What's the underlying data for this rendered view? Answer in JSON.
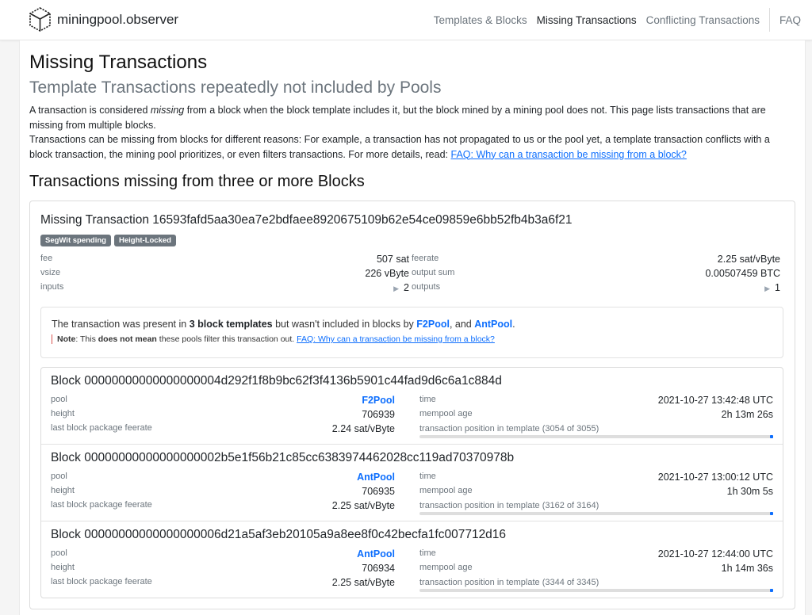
{
  "brand": {
    "name": "miningpool.observer",
    "logo_icon": "cube-icon"
  },
  "nav": {
    "items": [
      {
        "label": "Templates & Blocks",
        "active": false
      },
      {
        "label": "Missing Transactions",
        "active": true
      },
      {
        "label": "Conflicting Transactions",
        "active": false
      }
    ],
    "faq": "FAQ"
  },
  "page": {
    "title": "Missing Transactions",
    "subtitle": "Template Transactions repeatedly not included by Pools",
    "intro_1_a": "A transaction is considered ",
    "intro_1_em": "missing",
    "intro_1_b": " from a block when the block template includes it, but the block mined by a mining pool does not. This page lists transactions that are missing from multiple blocks.",
    "intro_2": "Transactions can be missing from blocks for different reasons: For example, a transaction has not propagated to us or the pool yet, a template transaction conflicts with a block transaction, the mining pool prioritizes, or even filters transactions. For more details, read: ",
    "intro_2_link": "FAQ: Why can a transaction be missing from a block?",
    "section_title": "Transactions missing from three or more Blocks"
  },
  "transaction": {
    "title": "Missing Transaction 16593fafd5aa30ea7e2bdfaee8920675109b62e54ce09859e6bb52fb4b3a6f21",
    "badges": [
      "SegWit spending",
      "Height-Locked"
    ],
    "fee_label": "fee",
    "fee": "507 sat",
    "vsize_label": "vsize",
    "vsize": "226 vByte",
    "inputs_label": "inputs",
    "inputs": "2",
    "feerate_label": "feerate",
    "feerate": "2.25 sat/vByte",
    "output_sum_label": "output sum",
    "output_sum": "0.00507459 BTC",
    "outputs_label": "outputs",
    "outputs": "1",
    "notice": {
      "text_a": "The transaction was present in ",
      "templates": "3 block templates",
      "text_b": " but wasn't included in blocks by ",
      "pool_1": "F2Pool",
      "text_c": ", and ",
      "pool_2": "AntPool",
      "text_d": ".",
      "note_label": "Note",
      "note_a": ": This ",
      "note_bold": "does not mean",
      "note_b": " these pools filter this transaction out. ",
      "note_link": "FAQ: Why can a transaction be missing from a block?"
    }
  },
  "blocks": [
    {
      "title": "Block 00000000000000000004d292f1f8b9bc62f3f4136b5901c44fad9d6c6a1c884d",
      "pool": "F2Pool",
      "height": "706939",
      "pkg_feerate": "2.24 sat/vByte",
      "time": "2021-10-27 13:42:48 UTC",
      "mempool_age": "2h 13m 26s",
      "position_text": "transaction position in template (3054 of 3055)",
      "position": 0.9997
    },
    {
      "title": "Block 00000000000000000002b5e1f56b21c85cc6383974462028cc119ad70370978b",
      "pool": "AntPool",
      "height": "706935",
      "pkg_feerate": "2.25 sat/vByte",
      "time": "2021-10-27 13:00:12 UTC",
      "mempool_age": "1h 30m 5s",
      "position_text": "transaction position in template (3162 of 3164)",
      "position": 0.9994
    },
    {
      "title": "Block 00000000000000000006d21a5af3eb20105a9a8ee8f0c42becfa1fc007712d16",
      "pool": "AntPool",
      "height": "706934",
      "pkg_feerate": "2.25 sat/vByte",
      "time": "2021-10-27 12:44:00 UTC",
      "mempool_age": "1h 14m 36s",
      "position_text": "transaction position in template (3344 of 3345)",
      "position": 0.9997
    }
  ],
  "block_labels": {
    "pool": "pool",
    "height": "height",
    "pkg_feerate": "last block package feerate",
    "time": "time",
    "mempool_age": "mempool age"
  }
}
